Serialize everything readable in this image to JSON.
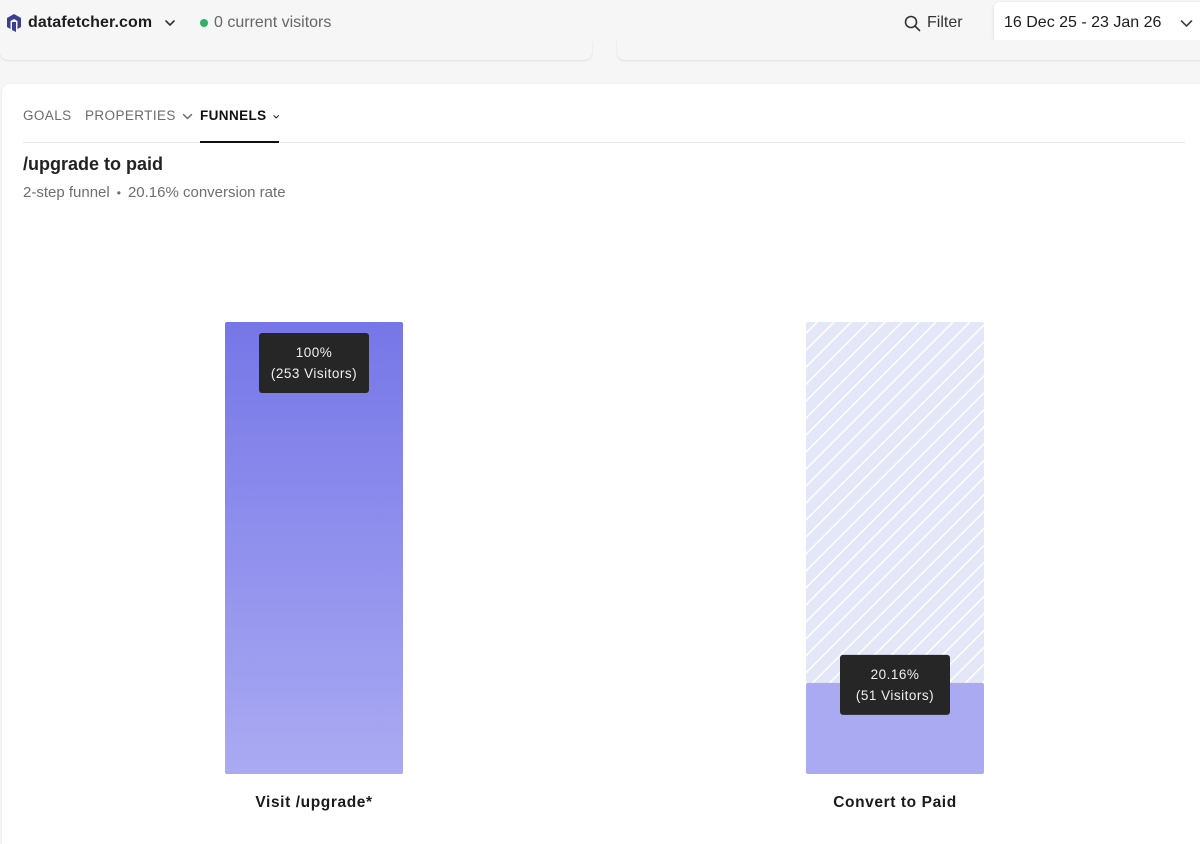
{
  "header": {
    "site_name": "datafetcher.com",
    "visitors_text": "0 current visitors",
    "filter_label": "Filter",
    "date_range": "16 Dec 25 - 23 Jan 26",
    "status_color": "#2fb36b"
  },
  "icons": {
    "logo": "datafetcher-logo",
    "site_menu": "chevron-down-icon",
    "filter": "search-icon",
    "date_menu": "chevron-down-icon"
  },
  "tabs": [
    {
      "label": "GOALS",
      "active": false,
      "has_menu": false
    },
    {
      "label": "PROPERTIES",
      "active": false,
      "has_menu": true
    },
    {
      "label": "FUNNELS",
      "active": true,
      "has_menu": true
    }
  ],
  "funnel": {
    "title": "/upgrade to paid",
    "steps_text": "2-step funnel",
    "separator": "•",
    "conversion_text": "20.16% conversion rate"
  },
  "chart_data": {
    "type": "bar",
    "categories": [
      "Visit /upgrade*",
      "Convert to Paid"
    ],
    "values": [
      100,
      20.16
    ],
    "visitors": [
      253,
      51
    ],
    "value_labels": [
      "100%",
      "20.16%"
    ],
    "visitor_labels": [
      "(253 Visitors)",
      "(51 Visitors)"
    ],
    "ylim": [
      0,
      100
    ],
    "colors": {
      "bar_top": "#7676e8",
      "bar_bottom": "#aaaaf2",
      "drop_off": "#e4e7f8",
      "tooltip": "#262626"
    }
  }
}
